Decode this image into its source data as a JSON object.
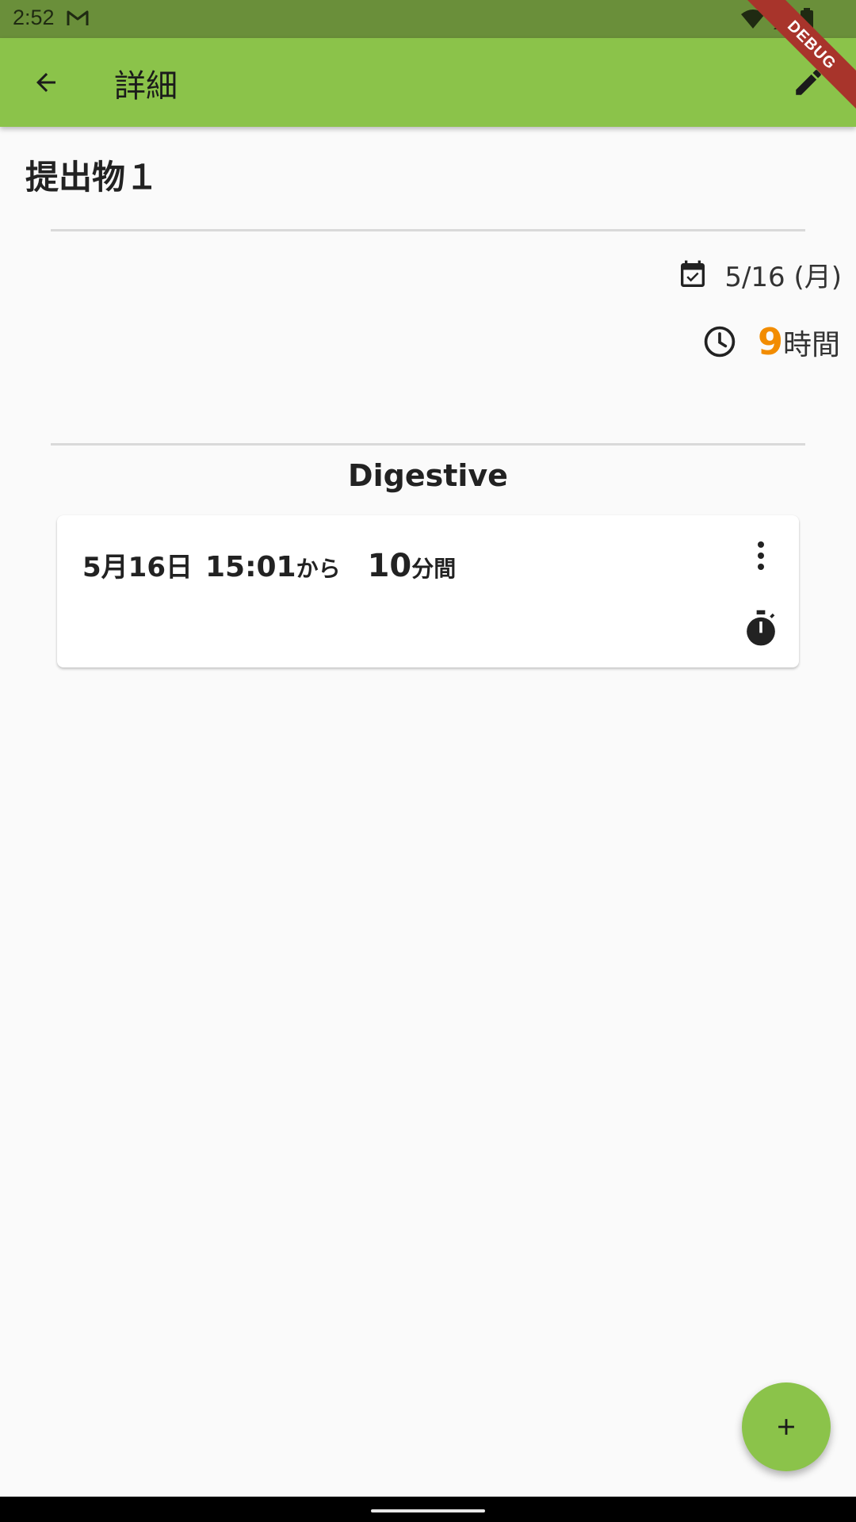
{
  "status_bar": {
    "time": "2:52"
  },
  "app_bar": {
    "title": "詳細"
  },
  "debug_banner": "DEBUG",
  "detail": {
    "title": "提出物１",
    "date": "5/16 (月)",
    "hours_value": "9",
    "hours_unit": "時間"
  },
  "section": {
    "title": "Digestive"
  },
  "sessions": [
    {
      "date": "5月16日",
      "time": "15:01",
      "from_label": "から",
      "minutes": "10",
      "minutes_unit": "分間"
    }
  ],
  "colors": {
    "app_bar": "#8bc34a",
    "status_bar": "#6a8f3a",
    "accent_hours": "#f28c00",
    "debug_banner": "#a8342b"
  },
  "icons": {
    "back": "arrow-back-icon",
    "edit": "pencil-icon",
    "date": "calendar-check-icon",
    "hours": "clock-icon",
    "more": "more-vert-icon",
    "timer": "stopwatch-icon",
    "fab": "plus-icon"
  }
}
